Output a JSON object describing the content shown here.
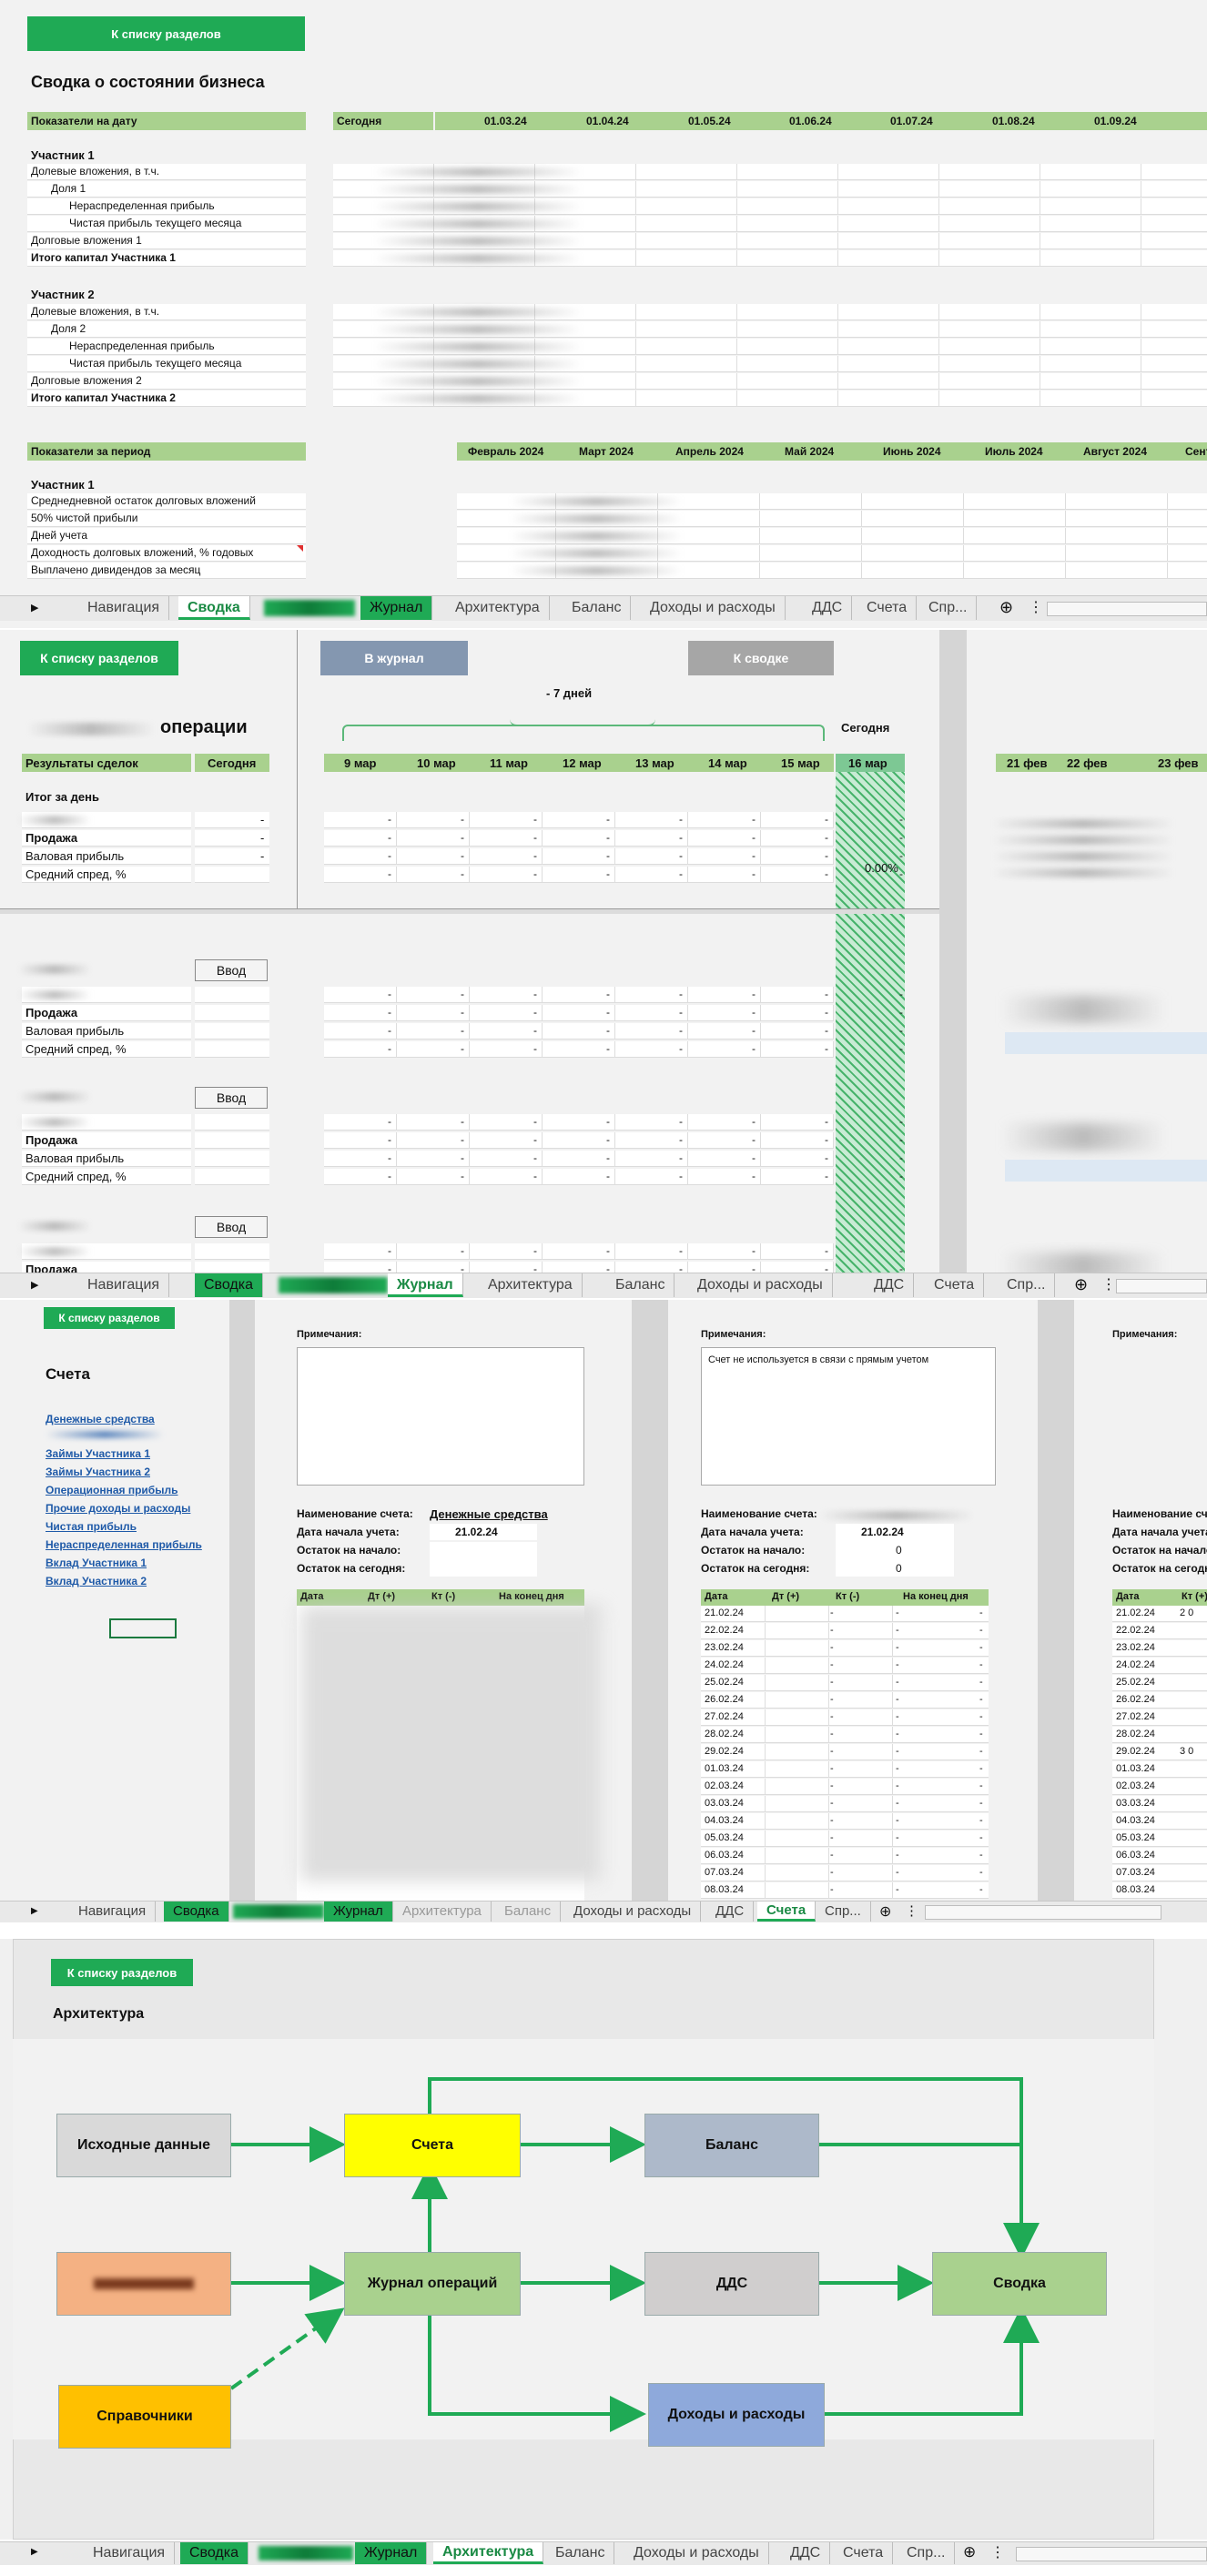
{
  "sections": {
    "back_button": "К списку разделов",
    "tabs": [
      "Навигация",
      "Сводка",
      "Журнал",
      "Архитектура",
      "Баланс",
      "Доходы и расходы",
      "ДДС",
      "Счета",
      "Спр..."
    ]
  },
  "summary": {
    "title": "Сводка о состоянии бизнеса",
    "date_header": "Показатели на дату",
    "today": "Сегодня",
    "dates": [
      "01.03.24",
      "01.04.24",
      "01.05.24",
      "01.06.24",
      "01.07.24",
      "01.08.24",
      "01.09.24"
    ],
    "participant1": {
      "title": "Участник 1",
      "rows": [
        "Долевые вложения, в т.ч.",
        "Доля 1",
        "Нераспределенная прибыль",
        "Чистая прибыль текущего месяца",
        "Долговые вложения 1",
        "Итого капитал Участника 1"
      ]
    },
    "participant2": {
      "title": "Участник 2",
      "rows": [
        "Долевые вложения, в т.ч.",
        "Доля 2",
        "Нераспределенная прибыль",
        "Чистая прибыль текущего месяца",
        "Долговые вложения 2",
        "Итого капитал Участника 2"
      ]
    },
    "period_header": "Показатели за период",
    "months": [
      "Февраль 2024",
      "Март 2024",
      "Апрель 2024",
      "Май 2024",
      "Июнь 2024",
      "Июль 2024",
      "Август 2024",
      "Сент"
    ],
    "period": {
      "title": "Участник 1",
      "rows": [
        "Среднедневной остаток долговых вложений",
        "50% чистой прибыли",
        "Дней учета",
        "Доходность долговых вложений, % годовых",
        "Выплачено дивидендов за месяц"
      ]
    }
  },
  "journal": {
    "to_journal": "В журнал",
    "to_summary": "К сводке",
    "title": "операции",
    "week_label": "- 7 дней",
    "today_label": "Сегодня",
    "results_header": "Результаты сделок",
    "today_col": "Сегодня",
    "days": [
      "9 мар",
      "10 мар",
      "11 мар",
      "12 мар",
      "13 мар",
      "14 мар",
      "15 мар"
    ],
    "today_day": "16 мар",
    "right_days": [
      "21 фев",
      "22 фев",
      "23 фев"
    ],
    "total_title": "Итог за день",
    "rows": [
      "Продажа",
      "Валовая прибыль",
      "Средний спред, %"
    ],
    "spread_today": "0.00%",
    "dash": "-",
    "input_button": "Ввод"
  },
  "accounts": {
    "title": "Счета",
    "links": [
      "Денежные средства",
      "Займы Участника 1",
      "Займы Участника 2",
      "Операционная прибыль",
      "Прочие доходы и расходы",
      "Чистая прибыль",
      "Нераспределенная прибыль",
      "Вклад Участника 1",
      "Вклад Участника 2"
    ],
    "notes_label": "Примечания:",
    "note_text": "Счет не используется в связи с прямым учетом",
    "name_label": "Наименование счета:",
    "start_label": "Дата начала учета:",
    "begin_label": "Остаток на начало:",
    "today_label": "Остаток на сегодня:",
    "acc1_name": "Денежные средства",
    "acc1_start": "21.02.24",
    "acc2_start": "21.02.24",
    "acc2_begin": "0",
    "acc2_today": "0",
    "cols": [
      "Дата",
      "Дт (+)",
      "Кт (-)",
      "На конец дня"
    ],
    "right_cols": [
      "Дата",
      "Кт (+)"
    ],
    "dates": [
      "21.02.24",
      "22.02.24",
      "23.02.24",
      "24.02.24",
      "25.02.24",
      "26.02.24",
      "27.02.24",
      "28.02.24",
      "29.02.24",
      "01.03.24",
      "02.03.24",
      "03.03.24",
      "04.03.24",
      "05.03.24",
      "06.03.24",
      "07.03.24",
      "08.03.24"
    ],
    "right_vals": {
      "row0": "2 0",
      "row8": "3 0"
    }
  },
  "architecture": {
    "title": "Архитектура",
    "nodes": {
      "source": "Исходные данные",
      "accounts": "Счета",
      "balance": "Баланс",
      "journal": "Журнал операций",
      "dds": "ДДС",
      "summary": "Сводка",
      "refs": "Справочники",
      "income": "Доходы и расходы"
    },
    "colors": {
      "green": "#1faa55",
      "yellow": "#ffff00",
      "gray_blue": "#adb9ca",
      "light_green": "#a9d18e",
      "gray": "#d0cece",
      "orange": "#f4b183",
      "gold": "#ffc000",
      "blue": "#8ea9db"
    }
  }
}
